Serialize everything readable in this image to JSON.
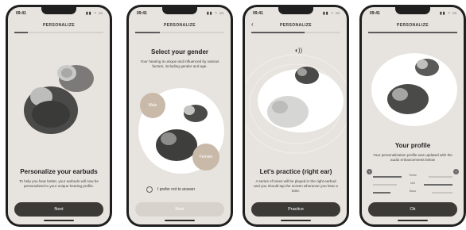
{
  "screens": [
    {
      "status": {
        "time": "09:41",
        "icons": "▮▮ ◔ ▭"
      },
      "header": "PERSONALIZE",
      "progress": 0.15,
      "title": "Personalize your earbuds",
      "body": "To help you hear better, your earbuds will now be personalized to your unique hearing profile.",
      "button": "Next"
    },
    {
      "status": {
        "time": "09:41",
        "icons": "▮▮ ◔ ▭"
      },
      "header": "PERSONALIZE",
      "progress": 0.28,
      "title": "Select your gender",
      "body": "Your hearing is unique and influenced by various factors, including gender and age.",
      "options": {
        "male": "Male",
        "female": "Female"
      },
      "checkbox_label": "I prefer not to answer",
      "button": "Next"
    },
    {
      "status": {
        "time": "09:41",
        "icons": "▮▮ ◔ ▭"
      },
      "header": "PERSONALIZE",
      "back": "‹",
      "progress": 0.6,
      "title": "Let's practice (right ear)",
      "body": "A series of tones will be played in the right earbud and you should tap the screen whenever you hear a tone.",
      "button": "Practice"
    },
    {
      "status": {
        "time": "09:41",
        "icons": "▮▮ ◔ ▭"
      },
      "header": "PERSONALIZE",
      "progress": 1.0,
      "title": "Your profile",
      "body": "Your personalization profile was updated with the audio enhancements below",
      "eq_labels": [
        "Treble",
        "Mid",
        "Bass"
      ],
      "button": "Ok"
    }
  ]
}
